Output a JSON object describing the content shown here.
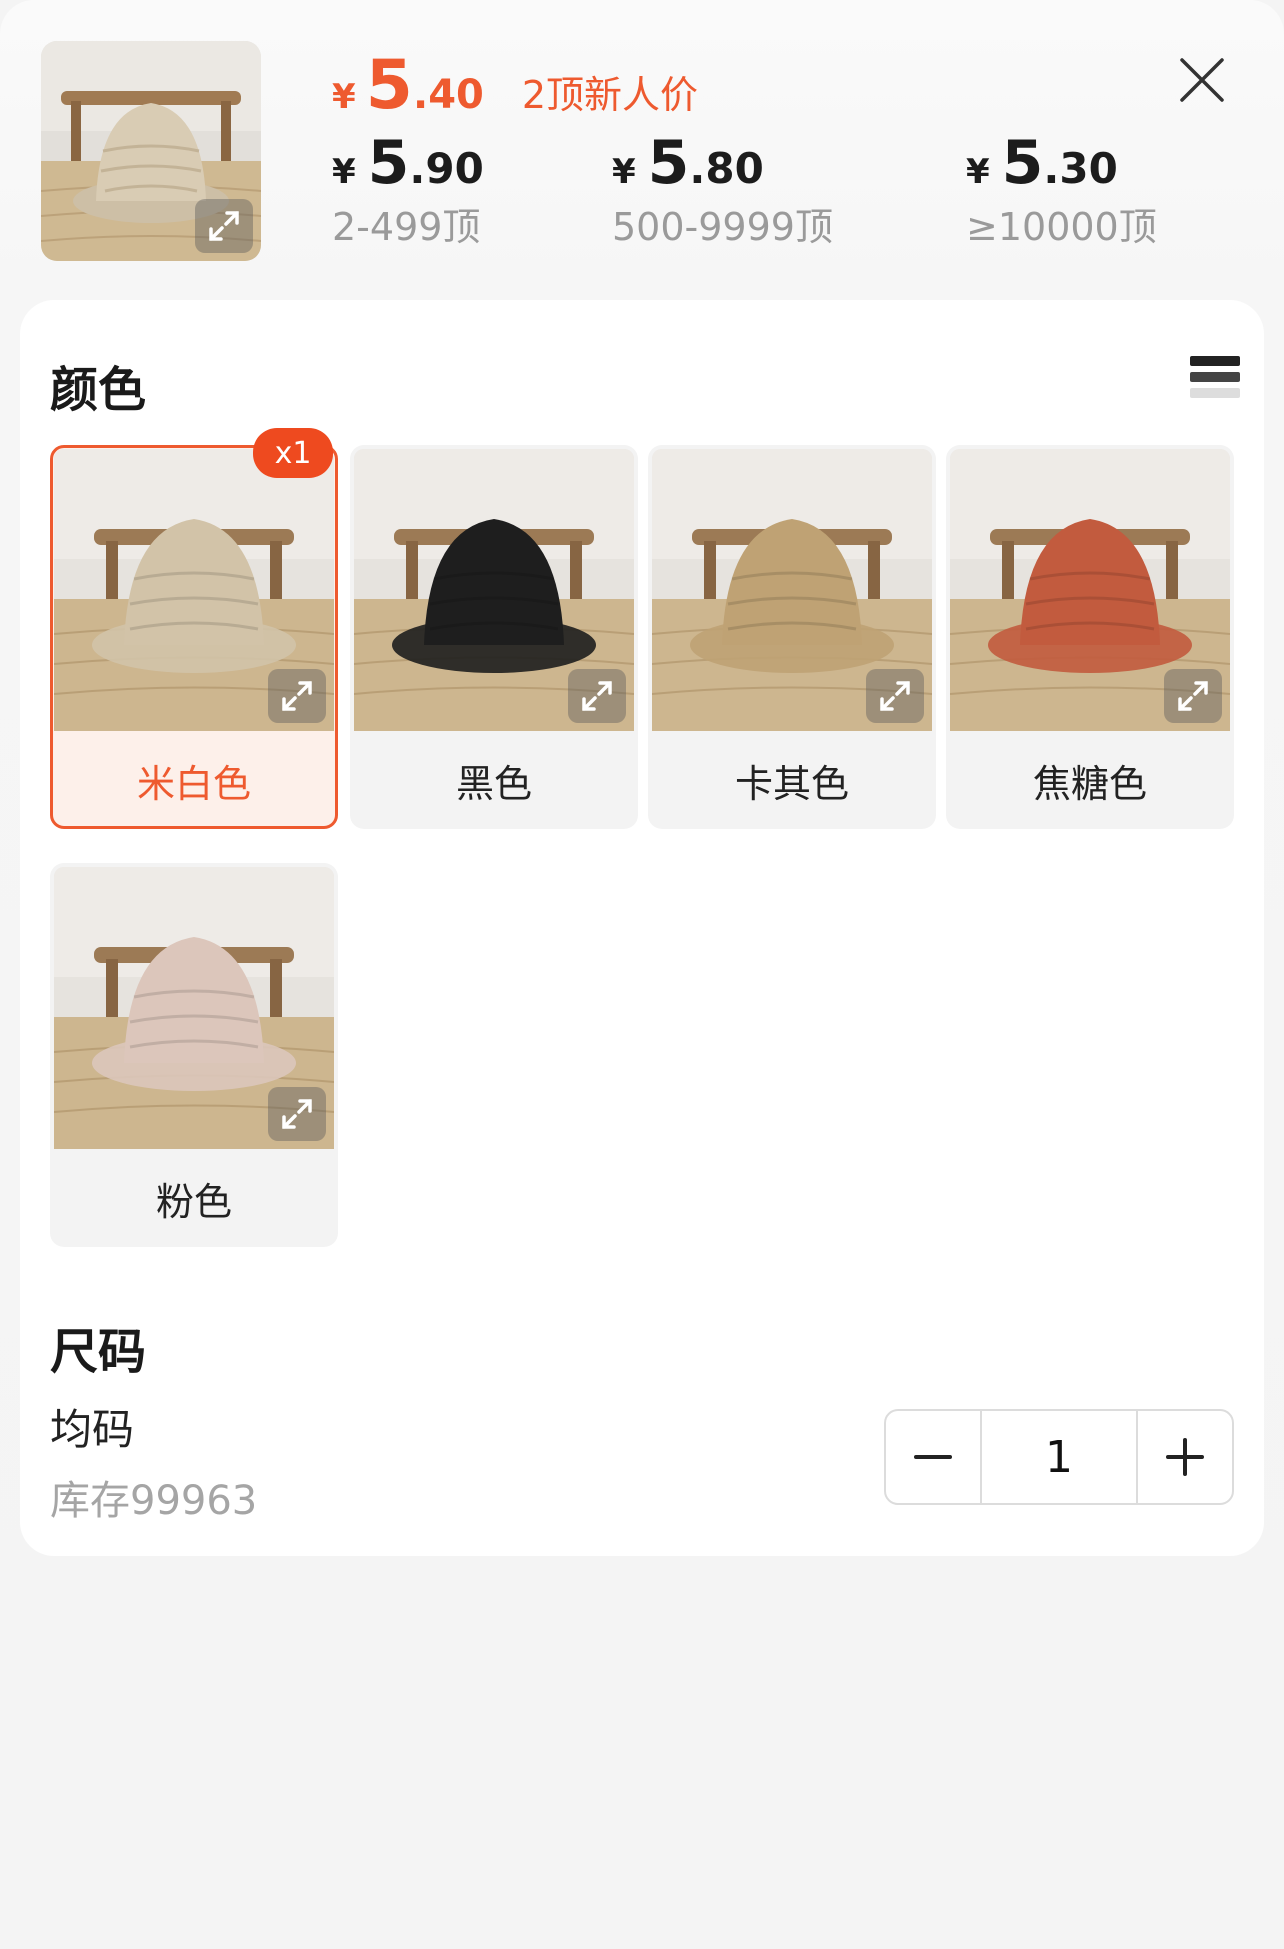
{
  "header": {
    "currency": "¥",
    "new_price": {
      "int": "5",
      "dec": ".40",
      "label": "2顶新人价"
    },
    "tiers": [
      {
        "int": "5",
        "dec": ".90",
        "range": "2-499顶"
      },
      {
        "int": "5",
        "dec": ".80",
        "range": "500-9999顶"
      },
      {
        "int": "5",
        "dec": ".30",
        "range": "≥10000顶"
      }
    ]
  },
  "colors": {
    "title": "颜色",
    "options": [
      {
        "label": "米白色",
        "hat": "#d2c3a8",
        "selected": true,
        "qty": "x1"
      },
      {
        "label": "黑色",
        "hat": "#1e1e1e",
        "selected": false
      },
      {
        "label": "卡其色",
        "hat": "#bfa274",
        "selected": false
      },
      {
        "label": "焦糖色",
        "hat": "#c25b3e",
        "selected": false
      },
      {
        "label": "粉色",
        "hat": "#dcc6bb",
        "selected": false
      }
    ]
  },
  "size": {
    "title": "尺码",
    "name": "均码",
    "stock": "库存99963",
    "quantity": "1"
  },
  "theme": {
    "accent": "#ee5a2f",
    "text": "#1c1c1c",
    "muted": "#9a9a9a"
  }
}
